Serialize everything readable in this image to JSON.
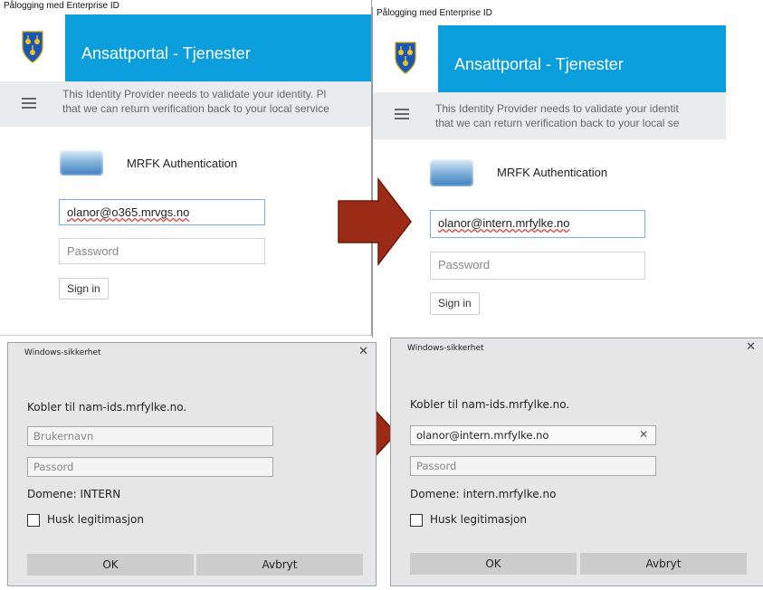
{
  "left_login": {
    "window_title": "Pålogging med Enterprise ID",
    "app_title": "Ansattportal - Tjenester",
    "info_line1": "This Identity Provider needs to validate your identity. Pl",
    "info_line2": "that we can return verification back to your local service",
    "provider_name": "MRFK Authentication",
    "username_value": "olanor@o365.mrvgs.no",
    "password_placeholder": "Password",
    "signin_label": "Sign in"
  },
  "right_login": {
    "window_title": "Pålogging med Enterprise ID",
    "app_title": "Ansattportal - Tjenester",
    "info_line1": "This Identity Provider needs to validate your identit",
    "info_line2": "that we can return verification back to your local se",
    "provider_name": "MRFK Authentication",
    "username_value": "olanor@intern.mrfylke.no",
    "password_placeholder": "Password",
    "signin_label": "Sign in"
  },
  "left_dialog": {
    "title": "Windows-sikkerhet",
    "close": "✕",
    "connecting_text": "Kobler til nam-ids.mrfylke.no.",
    "username_placeholder": "Brukernavn",
    "password_placeholder": "Passord",
    "domain_text": "Domene: INTERN",
    "remember_label": "Husk legitimasjon",
    "ok_label": "OK",
    "cancel_label": "Avbryt"
  },
  "right_dialog": {
    "title": "Windows-sikkerhet",
    "close": "✕",
    "connecting_text": "Kobler til nam-ids.mrfylke.no.",
    "username_value": "olanor@intern.mrfylke.no",
    "clear_icon": "✕",
    "password_placeholder": "Passord",
    "domain_text": "Domene: intern.mrfylke.no",
    "remember_label": "Husk legitimasjon",
    "ok_label": "OK",
    "cancel_label": "Avbryt"
  },
  "colors": {
    "header_blue": "#0a9edc",
    "arrow_red": "#9b2a16",
    "dialog_bg": "#e6e6e6"
  }
}
